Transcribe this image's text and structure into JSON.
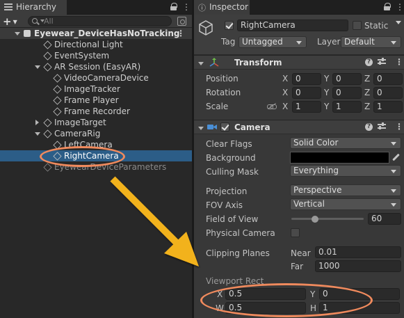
{
  "hierarchy": {
    "tab_label": "Hierarchy",
    "menu_glyph": "⋮",
    "add_label": "+",
    "search_placeholder": "All",
    "scene": {
      "name": "Eyewear_DeviceHasNoTracking",
      "more": "⋮"
    },
    "items": [
      {
        "label": "Directional Light"
      },
      {
        "label": "EventSystem"
      },
      {
        "label": "AR Session (EasyAR)"
      },
      {
        "label": "VideoCameraDevice"
      },
      {
        "label": "ImageTracker"
      },
      {
        "label": "Frame Player"
      },
      {
        "label": "Frame Recorder"
      },
      {
        "label": "ImageTarget"
      },
      {
        "label": "CameraRig"
      },
      {
        "label": "LeftCamera"
      },
      {
        "label": "RightCamera"
      },
      {
        "label": "EyewearDeviceParameters"
      }
    ]
  },
  "inspector": {
    "tab_label": "Inspector",
    "menu_glyph": "⋮",
    "object_name": "RightCamera",
    "active": true,
    "static_label": "Static",
    "tag_label": "Tag",
    "tag_value": "Untagged",
    "layer_label": "Layer",
    "layer_value": "Default",
    "transform": {
      "title": "Transform",
      "position_label": "Position",
      "rotation_label": "Rotation",
      "scale_label": "Scale",
      "x": "X",
      "y": "Y",
      "z": "Z",
      "position": [
        "0",
        "0",
        "0"
      ],
      "rotation": [
        "0",
        "0",
        "0"
      ],
      "scale": [
        "1",
        "1",
        "1"
      ]
    },
    "camera": {
      "title": "Camera",
      "clear_flags_label": "Clear Flags",
      "clear_flags_value": "Solid Color",
      "background_label": "Background",
      "background_color": "#000000",
      "culling_mask_label": "Culling Mask",
      "culling_mask_value": "Everything",
      "projection_label": "Projection",
      "projection_value": "Perspective",
      "fov_axis_label": "FOV Axis",
      "fov_axis_value": "Vertical",
      "fov_label": "Field of View",
      "fov_value": "60",
      "fov_fraction": 0.33,
      "physical_camera_label": "Physical Camera",
      "clipping_label": "Clipping Planes",
      "near_label": "Near",
      "near_value": "0.01",
      "far_label": "Far",
      "far_value": "1000",
      "viewport_label": "Viewport Rect",
      "vp_x_label": "X",
      "vp_x_value": "0.5",
      "vp_y_label": "Y",
      "vp_y_value": "0",
      "vp_w_label": "W",
      "vp_w_value": "0.5",
      "vp_h_label": "H",
      "vp_h_value": "1"
    }
  },
  "colors": {
    "selection": "#2c5d87",
    "annotation": "#f08a5d",
    "arrow": "#f2b21d"
  }
}
